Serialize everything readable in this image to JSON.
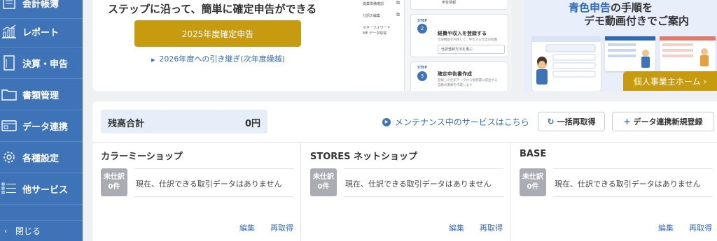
{
  "sidebar": {
    "items": [
      {
        "label": "会計帳簿",
        "icon": "ledger-icon"
      },
      {
        "label": "レポート",
        "icon": "report-chart-icon"
      },
      {
        "label": "決算・申告",
        "icon": "tax-return-icon"
      },
      {
        "label": "書類管理",
        "icon": "folder-icon"
      },
      {
        "label": "データ連携",
        "icon": "data-link-icon"
      },
      {
        "label": "各種設定",
        "icon": "gear-icon"
      },
      {
        "label": "他サービス",
        "icon": "grid-list-icon"
      }
    ],
    "close_label": "閉じる"
  },
  "tax_card": {
    "description": "ステップに沿って、簡単に確定申告ができる",
    "primary_button": "2025年度確定申告",
    "carry_link": "2026年度への引き継ぎ(次年度繰越)",
    "preview": {
      "side_items": [
        "開業準備確認",
        "仕訳の編集",
        "マネーフォワード",
        "ME データ取得"
      ],
      "top_label": "申告情報",
      "step2_tag": "STEP",
      "step2_num": "2",
      "step2_title": "経費や収入を登録する",
      "step2_sub": "仕訳機能を利用して、申告する年度の経費",
      "step2_field": "仕訳登録方法を選ぶ",
      "step3_tag": "STEP",
      "step3_num": "3",
      "step3_title": "確定申告書作成",
      "step3_sub1": "登録した仕訳データから税務署に提出する",
      "step3_sub2": "自動の書類を作成します"
    }
  },
  "promo_card": {
    "line1_highlight": "青色申告",
    "line1_rest": "の手順を",
    "line2": "デモ動画付きでご案内",
    "button": "個人事業主ホーム ›"
  },
  "data_panel": {
    "balance_label": "残高合計",
    "balance_value": "0円",
    "maintenance_link": "メンテナンス中のサービスはこちら",
    "refresh_all_button": "一括再取得",
    "new_link_button": "データ連携新規登録",
    "shops": [
      {
        "name": "カラーミーショップ",
        "badge_top": "未仕訳",
        "badge_bottom": "0件",
        "message": "現在、仕訳できる取引データはありません",
        "edit": "編集",
        "refetch": "再取得"
      },
      {
        "name": "STORES ネットショップ",
        "badge_top": "未仕訳",
        "badge_bottom": "0件",
        "message": "現在、仕訳できる取引データはありません",
        "edit": "編集",
        "refetch": "再取得"
      },
      {
        "name": "BASE",
        "badge_top": "未仕訳",
        "badge_bottom": "0件",
        "message": "現在、仕訳できる取引データはありません",
        "edit": "編集",
        "refetch": "再取得"
      }
    ]
  },
  "colors": {
    "sidebar_bg": "#3f73b8",
    "accent_gold": "#c79b10",
    "link_blue": "#3a6db3",
    "badge_gray": "#a9acb3"
  }
}
